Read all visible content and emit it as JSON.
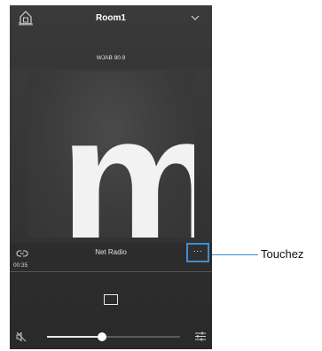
{
  "header": {
    "home_label": "Rooms",
    "room_title": "Room1"
  },
  "now_playing": {
    "station": "WJAB 90.9",
    "art_letter": "m",
    "source_label": "Net Radio",
    "more_label": "···",
    "elapsed": "00:35"
  },
  "volume": {
    "level": 0.41
  },
  "icons": {
    "home": "home-icon",
    "chevron": "chevron-down-icon",
    "link": "link-icon",
    "stop": "stop-icon",
    "mute": "mute-icon",
    "equalizer": "equalizer-icon"
  },
  "colors": {
    "accent": "#3d8fd3",
    "background": "#2e2e2e",
    "text": "#ffffff"
  },
  "annotation": {
    "callout_label": "Touchez"
  }
}
